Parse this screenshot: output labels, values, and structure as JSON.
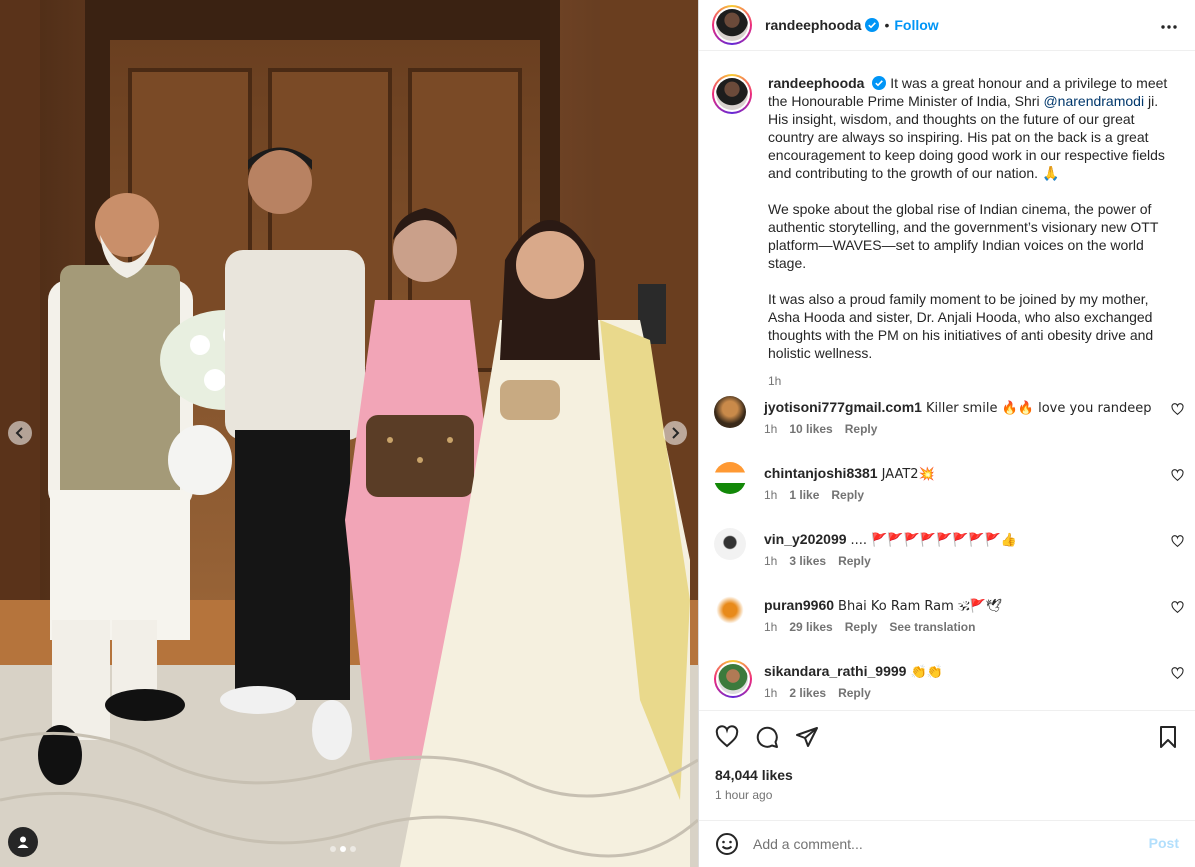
{
  "post": {
    "username": "randeephooda",
    "follow_label": "Follow",
    "dot": "•",
    "caption": {
      "username": "randeephooda",
      "p1_a": "It was a great honour and a privilege to meet the Honourable Prime Minister of India, Shri ",
      "p1_mention": "@narendramodi",
      "p1_b": " ji. His insight, wisdom, and thoughts on the future of our great country are always so inspiring. His pat on the back is a great encouragement to keep doing good work in our respective fields and contributing to the growth of our nation. 🙏",
      "p2": "We spoke about the global rise of Indian cinema, the power of authentic storytelling, and the government’s visionary new OTT platform—WAVES—set to amplify Indian voices on the world stage.",
      "p3": "It was also a proud family moment to be joined by my mother, Asha Hooda and sister, Dr. Anjali Hooda, who also exchanged thoughts with the PM on his initiatives of anti obesity drive and holistic wellness.",
      "time": "1h"
    },
    "comments": [
      {
        "user": "jyotisoni777gmail.com1",
        "text": "Killer smile 🔥🔥 love you randeep",
        "time": "1h",
        "likes": "10 likes",
        "reply": "Reply",
        "extra": ""
      },
      {
        "user": "chintanjoshi8381",
        "text": "JAAT2💥",
        "time": "1h",
        "likes": "1 like",
        "reply": "Reply",
        "extra": ""
      },
      {
        "user": "vin_y202099",
        "text": ".... 🚩🚩🚩🚩🚩🚩🚩🚩👍",
        "time": "1h",
        "likes": "3 likes",
        "reply": "Reply",
        "extra": ""
      },
      {
        "user": "puran9960",
        "text": "Bhai Ko Ram Ram 🕉🚩🕊",
        "time": "1h",
        "likes": "29 likes",
        "reply": "Reply",
        "extra": "See translation"
      },
      {
        "user": "sikandara_rathi_9999",
        "text": "👏👏",
        "time": "1h",
        "likes": "2 likes",
        "reply": "Reply",
        "extra": ""
      }
    ],
    "likes_count": "84,044 likes",
    "posted_ago": "1 hour ago",
    "add_comment_placeholder": "Add a comment...",
    "post_label": "Post"
  },
  "colors": {
    "accent": "#0095f6",
    "text": "#262626",
    "secondary": "#737373"
  }
}
